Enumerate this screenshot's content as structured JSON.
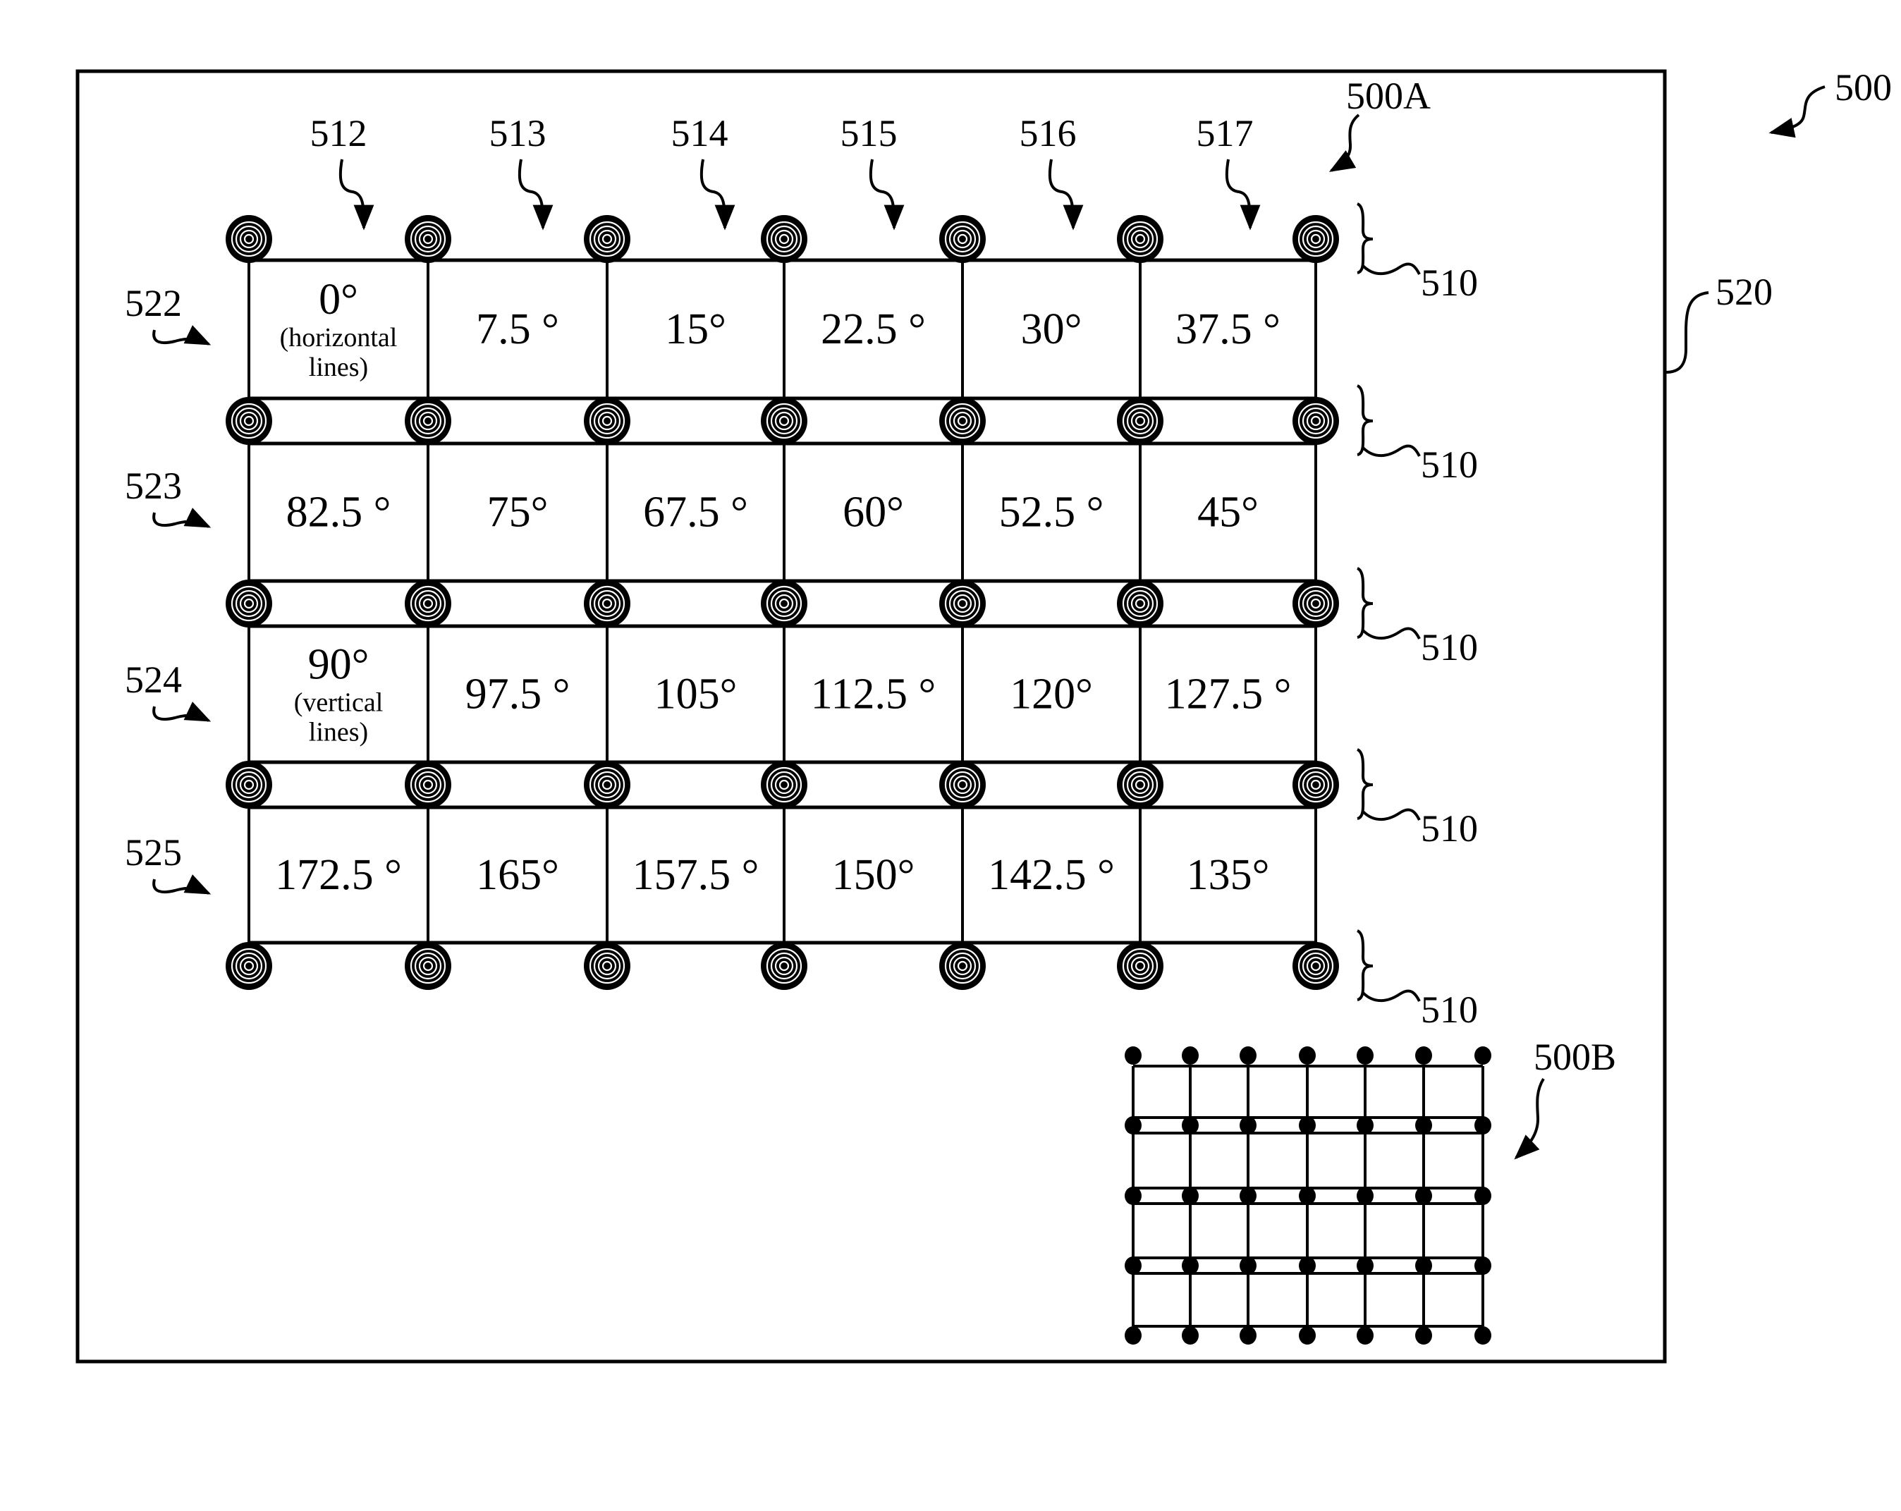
{
  "figure": {
    "number_label": "500",
    "panel_a_label": "500A",
    "panel_b_label": "500B",
    "substrate_label": "520",
    "node_row_label": "510",
    "column_labels": [
      "512",
      "513",
      "514",
      "515",
      "516",
      "517"
    ],
    "row_labels": [
      "522",
      "523",
      "524",
      "525"
    ]
  },
  "panel_a": {
    "node_style": "concentric-ring-pad",
    "rows": [
      {
        "label": "522",
        "cells": [
          {
            "angle": "0°",
            "note": [
              "(horizontal",
              "lines)"
            ]
          },
          {
            "angle": "7.5 °"
          },
          {
            "angle": "15°"
          },
          {
            "angle": "22.5 °"
          },
          {
            "angle": "30°"
          },
          {
            "angle": "37.5 °"
          }
        ]
      },
      {
        "label": "523",
        "cells": [
          {
            "angle": "82.5 °"
          },
          {
            "angle": "75°"
          },
          {
            "angle": "67.5 °"
          },
          {
            "angle": "60°"
          },
          {
            "angle": "52.5 °"
          },
          {
            "angle": "45°"
          }
        ]
      },
      {
        "label": "524",
        "cells": [
          {
            "angle": "90°",
            "note": [
              "(vertical",
              "lines)"
            ]
          },
          {
            "angle": "97.5 °"
          },
          {
            "angle": "105°"
          },
          {
            "angle": "112.5 °"
          },
          {
            "angle": "120°"
          },
          {
            "angle": "127.5 °"
          }
        ]
      },
      {
        "label": "525",
        "cells": [
          {
            "angle": "172.5 °"
          },
          {
            "angle": "165°"
          },
          {
            "angle": "157.5 °"
          },
          {
            "angle": "150°"
          },
          {
            "angle": "142.5 °"
          },
          {
            "angle": "135°"
          }
        ]
      }
    ],
    "node_rows": 5,
    "node_cols": 7
  },
  "panel_b": {
    "node_style": "solid-dot",
    "node_rows": 5,
    "node_cols": 7
  }
}
